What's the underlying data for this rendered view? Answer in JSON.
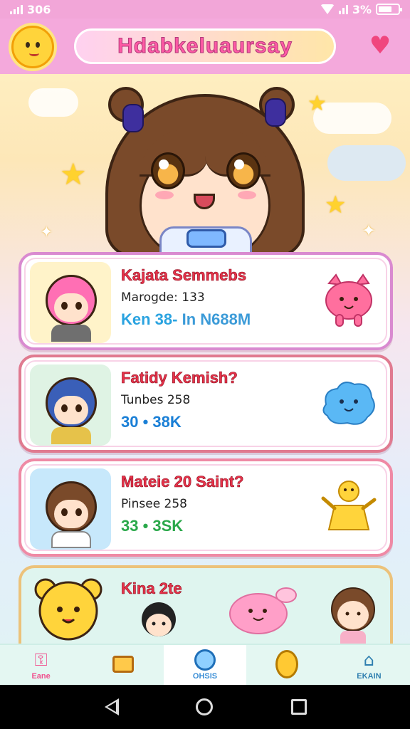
{
  "status_bar": {
    "signal_text": "306",
    "battery_text": "3%"
  },
  "header": {
    "title": "Hdabkeluaursay"
  },
  "cards": [
    {
      "title": "Kajata Semmebs",
      "subtitle": "Marogde: 133",
      "stat_a": "Ken 38-",
      "stat_b": " In N688M",
      "stat_a_color": "#2aa3e0",
      "stat_b_color": "#3c9bd8",
      "border_color": "#d98ad0"
    },
    {
      "title": "Fatidy Kemish?",
      "subtitle": "Tunbes 258",
      "stat_a": "30 • 38K",
      "stat_b": "",
      "stat_a_color": "#1a7fd6",
      "stat_b_color": "#1a7fd6",
      "border_color": "#e07a90"
    },
    {
      "title": "Mateie 20 Saint?",
      "subtitle": "Pinsee 258",
      "stat_a": "33 • 3SK",
      "stat_b": "",
      "stat_a_color": "#2aa84a",
      "stat_b_color": "#2aa84a",
      "border_color": "#ef8aa5"
    },
    {
      "title": "Kina 2te",
      "border_color": "#ecc27a"
    }
  ],
  "nav": [
    {
      "label": "Eane",
      "icon": "key-icon",
      "color": "#f0508e"
    },
    {
      "label": "",
      "icon": "tv-icon",
      "color": "#e08a1a"
    },
    {
      "label": "OHSIS",
      "icon": "bubble-icon",
      "color": "#3a8ed6"
    },
    {
      "label": "",
      "icon": "carrot-mascot-icon",
      "color": "#f5a623"
    },
    {
      "label": "EKAIN",
      "icon": "house-icon",
      "color": "#2f7fb0"
    }
  ]
}
